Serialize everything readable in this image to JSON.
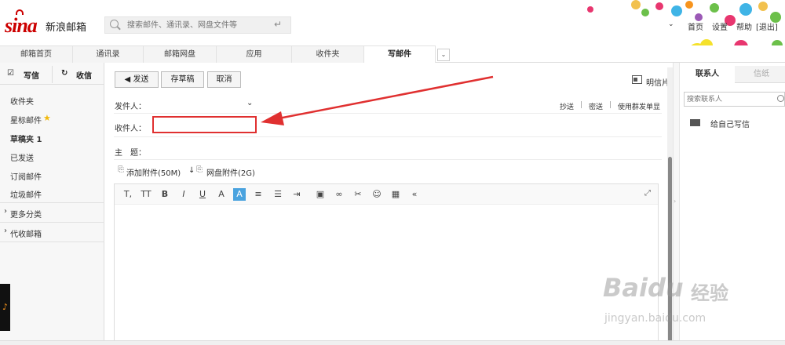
{
  "app": {
    "logo": "sina",
    "logo_text": "新浪邮箱",
    "brand_color": "#cc0000"
  },
  "search": {
    "placeholder": "搜索邮件、通讯录、网盘文件等",
    "icon": "search-icon",
    "enter_icon": "enter-icon",
    "enter_glyph": "↵"
  },
  "toplinks": {
    "dropdown_glyph": "⌄",
    "home": "首页",
    "settings": "设置",
    "help": "帮助",
    "logout": "[退出]"
  },
  "nav": {
    "tabs": [
      {
        "label": "邮箱首页",
        "active": false
      },
      {
        "label": "通讯录",
        "active": false
      },
      {
        "label": "邮箱网盘",
        "active": false
      },
      {
        "label": "应用",
        "active": false
      },
      {
        "label": "收件夹",
        "active": false
      },
      {
        "label": "写邮件",
        "active": true
      }
    ],
    "more_glyph": "⌄"
  },
  "sidebar": {
    "compose_label": "写信",
    "receive_label": "收信",
    "compose_glyph": "☑",
    "receive_glyph": "↻",
    "items": [
      {
        "label": "收件夹"
      },
      {
        "label": "星标邮件",
        "star": "★"
      },
      {
        "label": "草稿夹 1"
      },
      {
        "label": "已发送"
      },
      {
        "label": "订阅邮件"
      },
      {
        "label": "垃圾邮件"
      }
    ],
    "more_categories": "更多分类",
    "proxy_mailbox": "代收邮箱",
    "arrow_glyph": "›",
    "music_glyph": "♪"
  },
  "compose": {
    "send_label": "发送",
    "send_glyph": "◀",
    "draft_label": "存草稿",
    "cancel_label": "取消",
    "postcard_label": "明信片",
    "from_label": "发件人：",
    "from_dropdown_glyph": "⌄",
    "cc_link": "抄送",
    "bcc_link": "密送",
    "mass_link": "使用群发单显",
    "separator": "|",
    "to_label": "收件人：",
    "subject_label": "主　题：",
    "attach_label": "添加附件(50M)",
    "attach_arrow": "↓",
    "disk_attach_label": "网盘附件(2G)",
    "clip_glyph": "⎘",
    "recipient_value": ""
  },
  "editor": {
    "tools": [
      {
        "name": "font-family-icon",
        "glyph": "T,"
      },
      {
        "name": "font-size-icon",
        "glyph": "TT"
      },
      {
        "name": "bold-icon",
        "glyph": "B"
      },
      {
        "name": "italic-icon",
        "glyph": "I"
      },
      {
        "name": "underline-icon",
        "glyph": "U"
      },
      {
        "name": "font-color-icon",
        "glyph": "A"
      },
      {
        "name": "highlight-icon",
        "glyph": "A"
      },
      {
        "name": "align-icon",
        "glyph": "≡"
      },
      {
        "name": "list-icon",
        "glyph": "☰"
      },
      {
        "name": "indent-icon",
        "glyph": "⇥"
      },
      {
        "name": "image-icon",
        "glyph": "▣"
      },
      {
        "name": "link-icon",
        "glyph": "∞"
      },
      {
        "name": "cut-icon",
        "glyph": "✂"
      },
      {
        "name": "emoji-icon",
        "glyph": "☺"
      },
      {
        "name": "template-icon",
        "glyph": "▦"
      },
      {
        "name": "collapse-icon",
        "glyph": "«"
      }
    ],
    "expand_glyph": "⤢"
  },
  "rightpanel": {
    "tab_contacts": "联系人",
    "tab_stationery": "信纸",
    "search_placeholder": "搜索联系人",
    "self_label": "给自己写信",
    "collapse_glyph": "›"
  },
  "annotation": {
    "arrow_color": "#e03030"
  },
  "watermark": {
    "brand": "Baidu",
    "cn": "经验",
    "url": "jingyan.baidu.com"
  }
}
